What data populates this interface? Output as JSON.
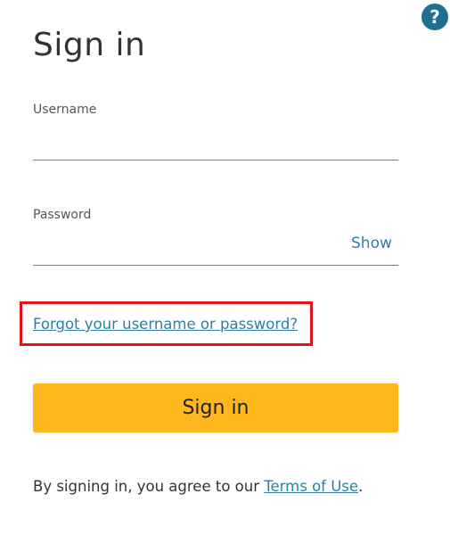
{
  "help": {
    "icon": "help-circle-icon",
    "glyph": "?"
  },
  "title": "Sign in",
  "username": {
    "label": "Username",
    "value": "",
    "placeholder": ""
  },
  "password": {
    "label": "Password",
    "value": "",
    "placeholder": "",
    "show_label": "Show"
  },
  "forgot_link": "Forgot your username or password?",
  "signin_button": "Sign in",
  "terms": {
    "prefix": "By signing in, you agree to our ",
    "link": "Terms of Use",
    "suffix": "."
  },
  "colors": {
    "accent_button": "#fdb81e",
    "link": "#2f7fa2",
    "help_icon": "#1f6f93",
    "highlight_border": "#e0141b"
  }
}
